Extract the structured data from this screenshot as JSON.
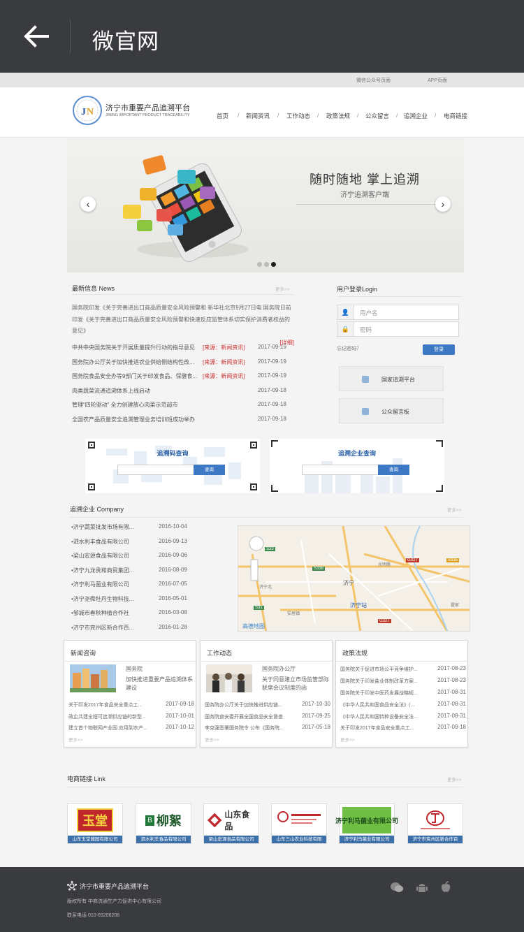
{
  "appbar": {
    "title": "微官网"
  },
  "topstrip": {
    "wechat": "微信公众号页面",
    "app": "APP页面"
  },
  "header": {
    "site_name": "济宁市重要产品追溯平台",
    "site_name_en": "JINING IMPORTANT PRODUCT TRACEABILITY",
    "nav": [
      "首页",
      "新闻资讯",
      "工作动态",
      "政策法规",
      "公众留言",
      "追溯企业",
      "电商链接"
    ]
  },
  "banner": {
    "headline": "随时随地 掌上追溯",
    "subline": "济宁追溯客户端"
  },
  "news": {
    "title": "最新信息 News",
    "more": "更多>>",
    "lead_text": "国务院印发《关于完善进出口商品质量安全风险预警和 新华社北京9月27日电 国务院日前印发《关于完善进出口商品质量安全风险预警和快速反应监管体系切实保护消费者权益的意见》",
    "lead_detail": "[详细]",
    "items": [
      {
        "title": "中共中央国务院关于开展质量提升行动的指导意见",
        "source": "[来源：新闻资讯]",
        "date": "2017-09-19"
      },
      {
        "title": "国务院办公厅关于加快推进农业供给侧结构性改...",
        "source": "[来源：新闻资讯]",
        "date": "2017-09-19"
      },
      {
        "title": "国务院食品安全办等9部门关于印发食品、保健食...",
        "source": "[来源：新闻资讯]",
        "date": "2017-09-19"
      },
      {
        "title": "肉类蔬菜流通追溯体系上线启动",
        "source": "",
        "date": "2017-09-18"
      },
      {
        "title": "管理“四轮驱动” 全力创建放心肉菜示范超市",
        "source": "",
        "date": "2017-09-18"
      },
      {
        "title": "全国农产品质量安全追溯管理业务培训班成功举办",
        "source": "",
        "date": "2017-09-18"
      }
    ]
  },
  "login": {
    "title": "用户登录Login",
    "username_placeholder": "用户名",
    "password_placeholder": "密码",
    "forgot": "忘记密码？",
    "button": "登录",
    "links": [
      "国家追溯平台",
      "公众留言板"
    ]
  },
  "query": {
    "code_title": "追溯码查询",
    "company_title": "追溯企业查询",
    "button": "查询"
  },
  "companies": {
    "title": "追溯企业 Company",
    "more": "更多>>",
    "items": [
      {
        "name": "•济宁蔬菜批发市场有限...",
        "date": "2016-10-04"
      },
      {
        "name": "•泗水利丰食品有限公司",
        "date": "2016-09-13"
      },
      {
        "name": "•梁山宏源食品有限公司",
        "date": "2016-09-06"
      },
      {
        "name": "•济宁九龙贵和商贸集团...",
        "date": "2016-08-09"
      },
      {
        "name": "•济宁利马菌业有限公司",
        "date": "2016-07-05"
      },
      {
        "name": "•济宁尧舜牡丹生物科技...",
        "date": "2016-05-01"
      },
      {
        "name": "•邹城市春秋种植合作社",
        "date": "2016-03-08"
      },
      {
        "name": "•济宁市兖州区新合作百...",
        "date": "2016-01-28"
      }
    ],
    "map_labels": {
      "city": "济宁",
      "station": "济宁站",
      "brand": "高德地图",
      "road1": "S33",
      "road2": "G327",
      "road3": "S338",
      "road4": "G327",
      "road5": "S335",
      "road6": "S31",
      "area": "安居镇",
      "v1": "光明路",
      "v2": "济宁北",
      "v3": "霍家"
    }
  },
  "cards": [
    {
      "title": "新闻咨询",
      "lead1": "国务院",
      "lead2": "加快推进重要产品追溯体系建设",
      "rows": [
        {
          "t": "关于印发2017年食品安全重点工...",
          "d": "2017-09-18"
        },
        {
          "t": "政企共建全程可追溯供应链的新型...",
          "d": "2017-10-01"
        },
        {
          "t": "建立首个物联网产业园 应用到农产...",
          "d": "2017-10-12"
        }
      ],
      "more": "更多>>"
    },
    {
      "title": "工作动态",
      "lead1": "国务院办公厅",
      "lead2": "关于同意建立市场监管部际联席会议制度的函",
      "rows": [
        {
          "t": "国务院办公厅关于加快推进供应链...",
          "d": "2017-10-30"
        },
        {
          "t": "国务院食安委开展全国食品安全督查",
          "d": "2017-09-25"
        },
        {
          "t": "李克强签署国务院令 公布《国务院...",
          "d": "2017-05-18"
        }
      ],
      "more": "更多>>"
    },
    {
      "title": "政策法规",
      "rows": [
        {
          "t": "国务院关于促进市场公平竞争维护...",
          "d": "2017-08-23"
        },
        {
          "t": "国务院关于印发盐业体制改革方案...",
          "d": "2017-08-23"
        },
        {
          "t": "国务院关于印发中医药发展战略规...",
          "d": "2017-08-31"
        },
        {
          "t": "《中华人民共和国食品安全法》(...",
          "d": "2017-08-31"
        },
        {
          "t": "《中华人民共和国特种设备安全法...",
          "d": "2017-08-31"
        },
        {
          "t": "关于印发2017年食品安全重点工...",
          "d": "2017-09-18"
        }
      ],
      "more": "更多>>"
    }
  ],
  "links": {
    "title": "电商链接  Link",
    "more": "更多>>",
    "items": [
      {
        "name": "山东玉堂酱园有限公司",
        "logo": "玉堂"
      },
      {
        "name": "泗水利丰食品有限公司",
        "logo": "柳絮"
      },
      {
        "name": "梁山宏源食品有限公司",
        "logo": "山东食品"
      },
      {
        "name": "山东三山农业科技有限",
        "logo": ""
      },
      {
        "name": "济宁利马菌业有限公司",
        "logo": "济宁利马菌业有限公司"
      },
      {
        "name": "济宁市兖州区新合作百",
        "logo": ""
      }
    ]
  },
  "footer": {
    "name": "济宁市重要产品追溯平台",
    "copyright": "版权所有   中商流通生产力促进中心有限公司",
    "phone": "联系电话   010-65206206"
  },
  "colors": {
    "appbar": "#3a3b3f",
    "accent": "#3c78c3",
    "source_red": "#cc3333"
  }
}
